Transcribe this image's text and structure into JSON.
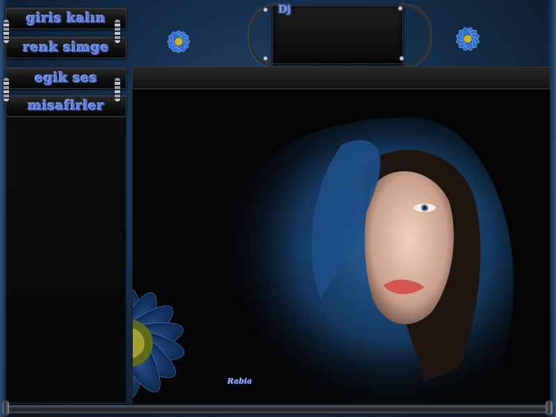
{
  "menu": {
    "items": [
      {
        "label": "giris kalın"
      },
      {
        "label": "renk simge"
      },
      {
        "label": "egik ses"
      },
      {
        "label": "misafirler"
      }
    ]
  },
  "header": {
    "dj_label": "Dj"
  },
  "artwork": {
    "signature": "Rabia",
    "theme_colors": {
      "accent": "#5d7ee0",
      "veil_blue": "#1f5a92",
      "frame": "#16304f"
    }
  }
}
